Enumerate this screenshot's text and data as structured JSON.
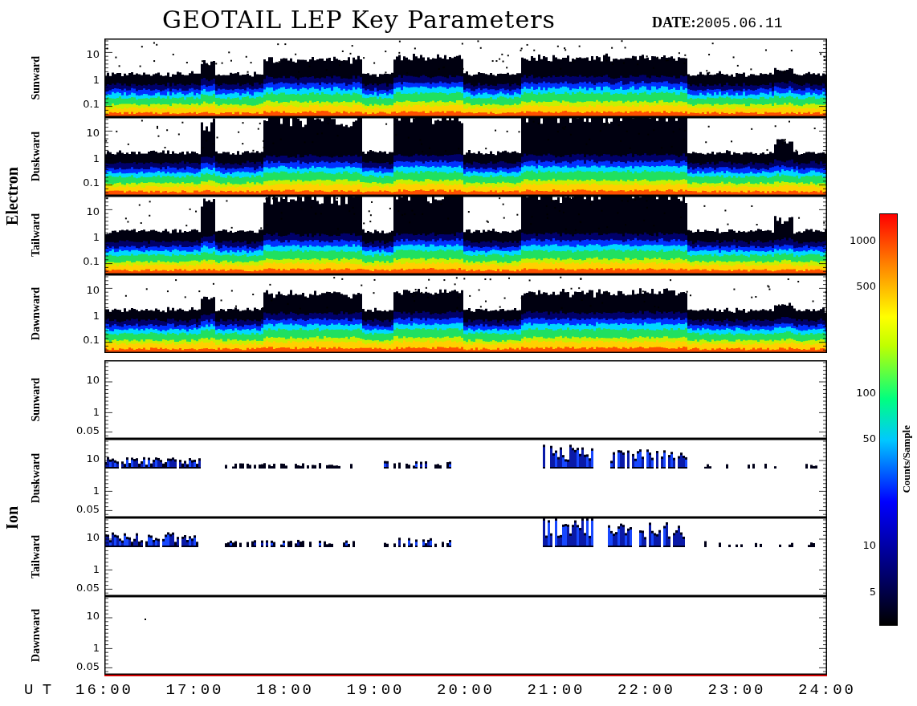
{
  "title": "GEOTAIL LEP Key Parameters",
  "date": "**DATE:**2005.06.11",
  "groups": [
    {
      "name": "Electron",
      "kind": "electron",
      "panels": [
        {
          "label": "Sunward",
          "yticks": [
            "10",
            "1",
            "0.1"
          ]
        },
        {
          "label": "Duskward",
          "yticks": [
            "10",
            "1",
            "0.1"
          ]
        },
        {
          "label": "Tailward",
          "yticks": [
            "10",
            "1",
            "0.1"
          ]
        },
        {
          "label": "Dawnward",
          "yticks": [
            "10",
            "1",
            "0.1"
          ]
        }
      ]
    },
    {
      "name": "Ion",
      "kind": "ion",
      "panels": [
        {
          "label": "Sunward",
          "yticks": [
            "10",
            "1",
            "0.05"
          ]
        },
        {
          "label": "Duskward",
          "yticks": [
            "10",
            "1",
            "0.05"
          ]
        },
        {
          "label": "Tailward",
          "yticks": [
            "10",
            "1",
            "0.05"
          ]
        },
        {
          "label": "Dawnward",
          "yticks": [
            "10",
            "1",
            "0.05"
          ]
        }
      ]
    }
  ],
  "x_axis": {
    "label": "U T",
    "ticks": [
      "16:00",
      "17:00",
      "18:00",
      "19:00",
      "20:00",
      "21:00",
      "22:00",
      "23:00",
      "24:00"
    ]
  },
  "colorbar": {
    "label": "Counts/Sample",
    "ticks": [
      "1000",
      "500",
      "100",
      "50",
      "10",
      "5"
    ]
  }
}
